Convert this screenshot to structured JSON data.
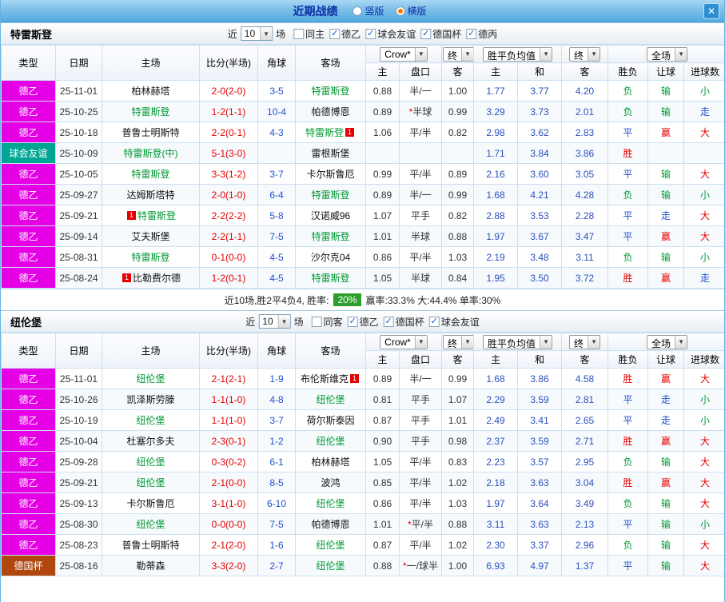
{
  "titlebar": {
    "title": "近期战绩",
    "options": [
      {
        "label": "竖版",
        "selected": false
      },
      {
        "label": "横版",
        "selected": true
      }
    ]
  },
  "icons": {
    "close": "✕",
    "dropdown": "▼",
    "check": "✓"
  },
  "columns": {
    "type": "类型",
    "date": "日期",
    "home": "主场",
    "score": "比分(半场)",
    "corner": "角球",
    "away": "客场",
    "group_odds": "Crow*",
    "group_final": "终",
    "group_avg": "胜平负均值",
    "group_final2": "终",
    "group_full": "全场",
    "sub_home": "主",
    "sub_handicap": "盘口",
    "sub_away": "客",
    "sub_avg_home": "主",
    "sub_avg_draw": "和",
    "sub_avg_away": "客",
    "sub_result": "胜负",
    "sub_handicap_result": "让球",
    "sub_goals": "进球数"
  },
  "type_colors": {
    "德乙": "#e500e5",
    "球会友谊": "#00a693",
    "德国杯": "#b1470f"
  },
  "result_colors": {
    "胜": "#e60000",
    "赢": "#e60000",
    "大": "#e60000",
    "平": "#2050cc",
    "走": "#2050cc",
    "负": "#009933",
    "输": "#009933",
    "小": "#009933"
  },
  "sections": [
    {
      "team": "特雷斯登",
      "filter": {
        "near_label": "近",
        "count": "10",
        "games_label": "场",
        "checkboxes": [
          {
            "label": "同主",
            "checked": false
          },
          {
            "label": "德乙",
            "checked": true
          },
          {
            "label": "球会友谊",
            "checked": true
          },
          {
            "label": "德国杯",
            "checked": true
          },
          {
            "label": "德丙",
            "checked": true
          }
        ]
      },
      "rows": [
        {
          "type": "德乙",
          "date": "25-11-01",
          "home": {
            "name": "柏林赫塔"
          },
          "score": "2-0(2-0)",
          "corner": "3-5",
          "away": {
            "name": "特雷斯登",
            "focal": true
          },
          "odds": [
            "0.88",
            "半/一",
            "1.00"
          ],
          "avg": [
            "1.77",
            "3.77",
            "4.20"
          ],
          "res": [
            "负",
            "输",
            "小"
          ]
        },
        {
          "type": "德乙",
          "date": "25-10-25",
          "home": {
            "name": "特雷斯登",
            "focal": true
          },
          "score": "1-2(1-1)",
          "corner": "10-4",
          "away": {
            "name": "帕德博恩"
          },
          "odds": [
            "0.89",
            "*半球",
            "0.99"
          ],
          "avg": [
            "3.29",
            "3.73",
            "2.01"
          ],
          "res": [
            "负",
            "输",
            "走"
          ]
        },
        {
          "type": "德乙",
          "date": "25-10-18",
          "home": {
            "name": "普鲁士明斯特"
          },
          "score": "2-2(0-1)",
          "corner": "4-3",
          "away": {
            "name": "特雷斯登",
            "focal": true,
            "badge": "1",
            "badge_pos": "after"
          },
          "odds": [
            "1.06",
            "平/半",
            "0.82"
          ],
          "avg": [
            "2.98",
            "3.62",
            "2.83"
          ],
          "res": [
            "平",
            "赢",
            "大"
          ]
        },
        {
          "type": "球会友谊",
          "date": "25-10-09",
          "home": {
            "name": "特雷斯登(中)",
            "focal": true
          },
          "score": "5-1(3-0)",
          "corner": "",
          "away": {
            "name": "雷根斯堡"
          },
          "odds": [
            "",
            "",
            ""
          ],
          "avg": [
            "1.71",
            "3.84",
            "3.86"
          ],
          "res": [
            "胜",
            "",
            ""
          ]
        },
        {
          "type": "德乙",
          "date": "25-10-05",
          "home": {
            "name": "特雷斯登",
            "focal": true
          },
          "score": "3-3(1-2)",
          "corner": "3-7",
          "away": {
            "name": "卡尔斯鲁厄"
          },
          "odds": [
            "0.99",
            "平/半",
            "0.89"
          ],
          "avg": [
            "2.16",
            "3.60",
            "3.05"
          ],
          "res": [
            "平",
            "输",
            "大"
          ]
        },
        {
          "type": "德乙",
          "date": "25-09-27",
          "home": {
            "name": "达姆斯塔特"
          },
          "score": "2-0(1-0)",
          "corner": "6-4",
          "away": {
            "name": "特雷斯登",
            "focal": true
          },
          "odds": [
            "0.89",
            "半/一",
            "0.99"
          ],
          "avg": [
            "1.68",
            "4.21",
            "4.28"
          ],
          "res": [
            "负",
            "输",
            "小"
          ]
        },
        {
          "type": "德乙",
          "date": "25-09-21",
          "home": {
            "name": "特雷斯登",
            "focal": true,
            "badge": "1",
            "badge_pos": "before"
          },
          "score": "2-2(2-2)",
          "corner": "5-8",
          "away": {
            "name": "汉诺威96"
          },
          "odds": [
            "1.07",
            "平手",
            "0.82"
          ],
          "avg": [
            "2.88",
            "3.53",
            "2.28"
          ],
          "res": [
            "平",
            "走",
            "大"
          ]
        },
        {
          "type": "德乙",
          "date": "25-09-14",
          "home": {
            "name": "艾夫斯堡"
          },
          "score": "2-2(1-1)",
          "corner": "7-5",
          "away": {
            "name": "特雷斯登",
            "focal": true
          },
          "odds": [
            "1.01",
            "半球",
            "0.88"
          ],
          "avg": [
            "1.97",
            "3.67",
            "3.47"
          ],
          "res": [
            "平",
            "赢",
            "大"
          ]
        },
        {
          "type": "德乙",
          "date": "25-08-31",
          "home": {
            "name": "特雷斯登",
            "focal": true
          },
          "score": "0-1(0-0)",
          "corner": "4-5",
          "away": {
            "name": "沙尔克04"
          },
          "odds": [
            "0.86",
            "平/半",
            "1.03"
          ],
          "avg": [
            "2.19",
            "3.48",
            "3.11"
          ],
          "res": [
            "负",
            "输",
            "小"
          ]
        },
        {
          "type": "德乙",
          "date": "25-08-24",
          "home": {
            "name": "比勒费尔德",
            "badge": "1",
            "badge_pos": "before"
          },
          "score": "1-2(0-1)",
          "corner": "4-5",
          "away": {
            "name": "特雷斯登",
            "focal": true
          },
          "odds": [
            "1.05",
            "半球",
            "0.84"
          ],
          "avg": [
            "1.95",
            "3.50",
            "3.72"
          ],
          "res": [
            "胜",
            "赢",
            "走"
          ]
        }
      ],
      "summary": {
        "lead": "近10场,胜2平4负4, 胜率:",
        "rate": "20%",
        "stats": "赢率:33.3% 大:44.4% 单率:30%"
      }
    },
    {
      "team": "纽伦堡",
      "filter": {
        "near_label": "近",
        "count": "10",
        "games_label": "场",
        "checkboxes": [
          {
            "label": "同客",
            "checked": false
          },
          {
            "label": "德乙",
            "checked": true
          },
          {
            "label": "德国杯",
            "checked": true
          },
          {
            "label": "球会友谊",
            "checked": true
          }
        ]
      },
      "rows": [
        {
          "type": "德乙",
          "date": "25-11-01",
          "home": {
            "name": "纽伦堡",
            "focal": true
          },
          "score": "2-1(2-1)",
          "corner": "1-9",
          "away": {
            "name": "布伦斯维克",
            "badge": "1",
            "badge_pos": "after"
          },
          "odds": [
            "0.89",
            "半/一",
            "0.99"
          ],
          "avg": [
            "1.68",
            "3.86",
            "4.58"
          ],
          "res": [
            "胜",
            "赢",
            "大"
          ]
        },
        {
          "type": "德乙",
          "date": "25-10-26",
          "home": {
            "name": "凯泽斯劳滕"
          },
          "score": "1-1(1-0)",
          "corner": "4-8",
          "away": {
            "name": "纽伦堡",
            "focal": true
          },
          "odds": [
            "0.81",
            "平手",
            "1.07"
          ],
          "avg": [
            "2.29",
            "3.59",
            "2.81"
          ],
          "res": [
            "平",
            "走",
            "小"
          ]
        },
        {
          "type": "德乙",
          "date": "25-10-19",
          "home": {
            "name": "纽伦堡",
            "focal": true
          },
          "score": "1-1(1-0)",
          "corner": "3-7",
          "away": {
            "name": "荷尔斯泰因"
          },
          "odds": [
            "0.87",
            "平手",
            "1.01"
          ],
          "avg": [
            "2.49",
            "3.41",
            "2.65"
          ],
          "res": [
            "平",
            "走",
            "小"
          ]
        },
        {
          "type": "德乙",
          "date": "25-10-04",
          "home": {
            "name": "杜塞尔多夫"
          },
          "score": "2-3(0-1)",
          "corner": "1-2",
          "away": {
            "name": "纽伦堡",
            "focal": true
          },
          "odds": [
            "0.90",
            "平手",
            "0.98"
          ],
          "avg": [
            "2.37",
            "3.59",
            "2.71"
          ],
          "res": [
            "胜",
            "赢",
            "大"
          ]
        },
        {
          "type": "德乙",
          "date": "25-09-28",
          "home": {
            "name": "纽伦堡",
            "focal": true
          },
          "score": "0-3(0-2)",
          "corner": "6-1",
          "away": {
            "name": "柏林赫塔"
          },
          "odds": [
            "1.05",
            "平/半",
            "0.83"
          ],
          "avg": [
            "2.23",
            "3.57",
            "2.95"
          ],
          "res": [
            "负",
            "输",
            "大"
          ]
        },
        {
          "type": "德乙",
          "date": "25-09-21",
          "home": {
            "name": "纽伦堡",
            "focal": true
          },
          "score": "2-1(0-0)",
          "corner": "8-5",
          "away": {
            "name": "波鸿"
          },
          "odds": [
            "0.85",
            "平/半",
            "1.02"
          ],
          "avg": [
            "2.18",
            "3.63",
            "3.04"
          ],
          "res": [
            "胜",
            "赢",
            "大"
          ]
        },
        {
          "type": "德乙",
          "date": "25-09-13",
          "home": {
            "name": "卡尔斯鲁厄"
          },
          "score": "3-1(1-0)",
          "corner": "6-10",
          "away": {
            "name": "纽伦堡",
            "focal": true
          },
          "odds": [
            "0.86",
            "平/半",
            "1.03"
          ],
          "avg": [
            "1.97",
            "3.64",
            "3.49"
          ],
          "res": [
            "负",
            "输",
            "大"
          ]
        },
        {
          "type": "德乙",
          "date": "25-08-30",
          "home": {
            "name": "纽伦堡",
            "focal": true
          },
          "score": "0-0(0-0)",
          "corner": "7-5",
          "away": {
            "name": "帕德博恩"
          },
          "odds": [
            "1.01",
            "*平/半",
            "0.88"
          ],
          "avg": [
            "3.11",
            "3.63",
            "2.13"
          ],
          "res": [
            "平",
            "输",
            "小"
          ]
        },
        {
          "type": "德乙",
          "date": "25-08-23",
          "home": {
            "name": "普鲁士明斯特"
          },
          "score": "2-1(2-0)",
          "corner": "1-6",
          "away": {
            "name": "纽伦堡",
            "focal": true
          },
          "odds": [
            "0.87",
            "平/半",
            "1.02"
          ],
          "avg": [
            "2.30",
            "3.37",
            "2.96"
          ],
          "res": [
            "负",
            "输",
            "大"
          ]
        },
        {
          "type": "德国杯",
          "date": "25-08-16",
          "home": {
            "name": "勒蒂森"
          },
          "score": "3-3(2-0)",
          "corner": "2-7",
          "away": {
            "name": "纽伦堡",
            "focal": true
          },
          "odds": [
            "0.88",
            "*一/球半",
            "1.00"
          ],
          "avg": [
            "6.93",
            "4.97",
            "1.37"
          ],
          "res": [
            "平",
            "输",
            "大"
          ]
        }
      ]
    }
  ]
}
